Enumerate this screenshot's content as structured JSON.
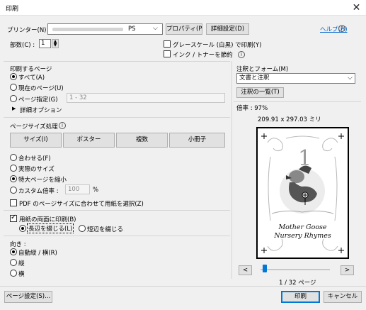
{
  "window": {
    "title": "印刷",
    "close_icon": "close-icon"
  },
  "printer": {
    "label": "プリンター(N) :",
    "value_suffix": "PS",
    "properties_button": "プロパティ(P)",
    "advanced_button": "詳細設定(D)",
    "help_link": "ヘルプ(H)"
  },
  "copies": {
    "label": "部数(C) :",
    "value": "1"
  },
  "options": {
    "grayscale": "グレースケール (白黒) で印刷(Y)",
    "grayscale_checked": false,
    "ink_save": "インク / トナーを節約",
    "ink_save_checked": false
  },
  "pages": {
    "section_label": "印刷するページ",
    "all": "すべて(A)",
    "current": "現在のページ(U)",
    "range": "ページ指定(G)",
    "range_placeholder": "1 - 32",
    "more_options": "詳細オプション",
    "selected": "all"
  },
  "sizing": {
    "section_label": "ページサイズ処理",
    "buttons": [
      "サイズ(I)",
      "ポスター",
      "複数",
      "小冊子"
    ],
    "fit": "合わせる(F)",
    "actual": "実際のサイズ",
    "shrink": "特大ページを縮小",
    "custom": "カスタム倍率 :",
    "custom_value": "100",
    "custom_unit": "%",
    "pdf_paper": "PDF のページサイズに合わせて用紙を選択(Z)",
    "selected": "shrink"
  },
  "duplex": {
    "label": "用紙の両面に印刷(B)",
    "checked": true,
    "long": "長辺を綴じる(L)",
    "short": "短辺を綴じる"
  },
  "orientation": {
    "label": "向き :",
    "auto": "自動縦 / 横(R)",
    "portrait": "縦",
    "landscape": "横"
  },
  "comments": {
    "label": "注釈とフォーム(M)",
    "value": "文書と注釈",
    "summary_button": "注釈の一覧(T)"
  },
  "preview": {
    "scale": "倍率 : 97%",
    "size": "209.91 x 297.03 ミリ",
    "page_number": "1",
    "caption1": "Mother Goose",
    "caption2": "Nursery Rhymes",
    "page_count": "1 / 32 ページ",
    "prev": "<",
    "next": ">",
    "progress": 0.03
  },
  "footer": {
    "page_setup": "ページ設定(S)...",
    "print": "印刷",
    "cancel": "キャンセル"
  },
  "colors": {
    "accent": "#0078d7",
    "link": "#0066cc"
  }
}
